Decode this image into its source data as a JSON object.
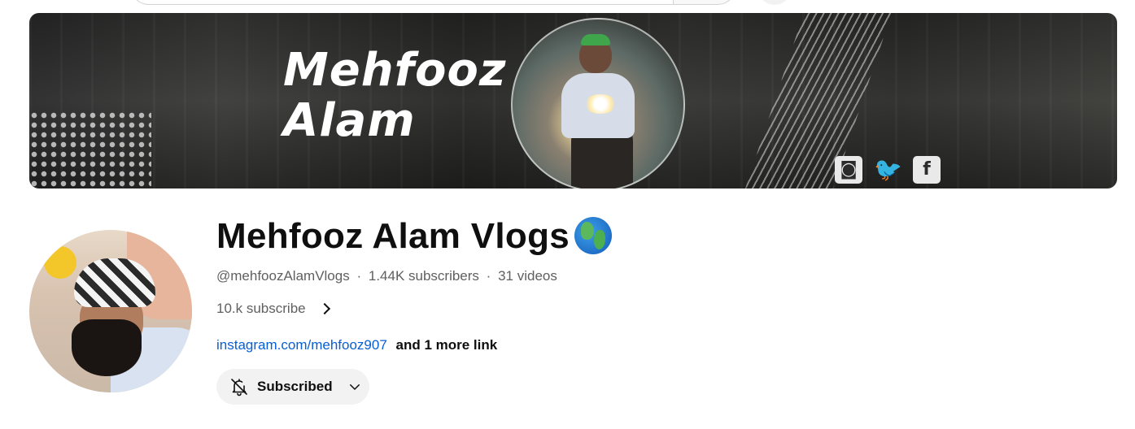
{
  "banner": {
    "title_line1": "Mehfooz",
    "title_line2": "Alam",
    "social_icons": [
      "instagram-icon",
      "twitter-icon",
      "facebook-icon"
    ],
    "social_glyphs": [
      "◙",
      "🐦",
      "f"
    ]
  },
  "channel": {
    "name": "Mehfooz Alam Vlogs",
    "handle": "@mehfoozAlamVlogs",
    "separator": "·",
    "subscribers": "1.44K subscribers",
    "videos": "31 videos",
    "about_text": "10.k subscribe",
    "primary_link": "instagram.com/mehfooz907",
    "more_links": "and 1 more link",
    "badge_icon": "globe-icon"
  },
  "subscribe": {
    "label": "Subscribed",
    "icon": "bell-off-icon"
  },
  "colors": {
    "link": "#065fd4",
    "text_primary": "#0f0f0f",
    "text_secondary": "#606060",
    "button_bg": "#f2f2f2"
  }
}
